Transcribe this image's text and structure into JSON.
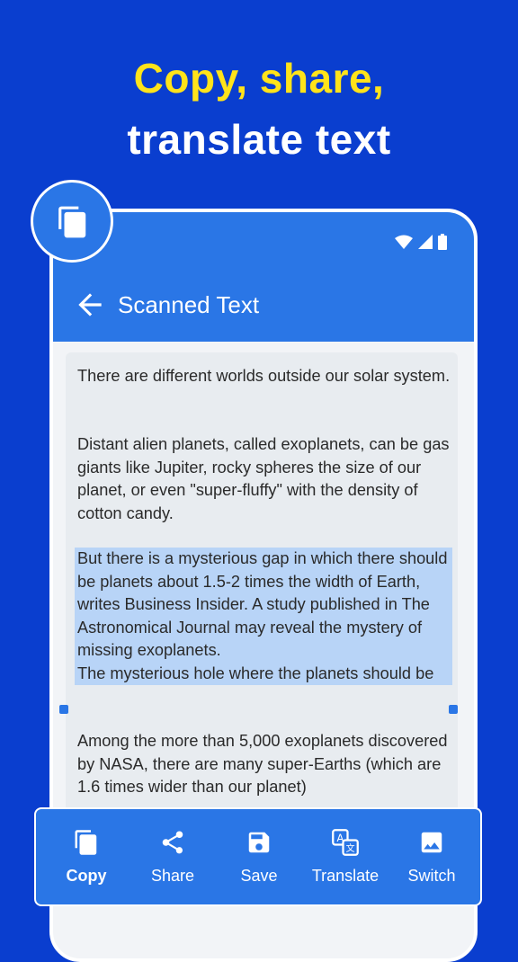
{
  "headline": {
    "line1": "Copy, share,",
    "line2": "translate text"
  },
  "app": {
    "title": "Scanned Text",
    "back_icon": "arrow-left-icon"
  },
  "status_icons": [
    "wifi-icon",
    "cellular-icon",
    "battery-icon"
  ],
  "scanned_text": {
    "paragraphs": [
      "There are different worlds outside our solar system.",
      "Distant alien planets, called exoplanets, can be gas giants like Jupiter, rocky spheres the size of our planet, or even \"super-fluffy\" with the density of cotton candy.",
      "But there is a mysterious gap in which there should be planets about 1.5-2 times the width of Earth, writes Business Insider. A study published in The Astronomical Journal may reveal the mystery of missing exoplanets.\nThe mysterious hole where the planets should be",
      "Among the more than 5,000 exoplanets discovered by NASA, there are many super-Earths (which are 1.6 times wider than our planet)"
    ],
    "selected_paragraph_index": 2
  },
  "toolbar": {
    "items": [
      {
        "label": "Copy",
        "icon": "copy-icon",
        "active": true
      },
      {
        "label": "Share",
        "icon": "share-icon",
        "active": false
      },
      {
        "label": "Save",
        "icon": "save-icon",
        "active": false
      },
      {
        "label": "Translate",
        "icon": "translate-icon",
        "active": false
      },
      {
        "label": "Switch",
        "icon": "image-icon",
        "active": false
      }
    ]
  },
  "colors": {
    "background": "#0a3ecf",
    "accent": "#2a76e6",
    "headline_yellow": "#ffe31a",
    "selection": "#b8d4f7"
  }
}
